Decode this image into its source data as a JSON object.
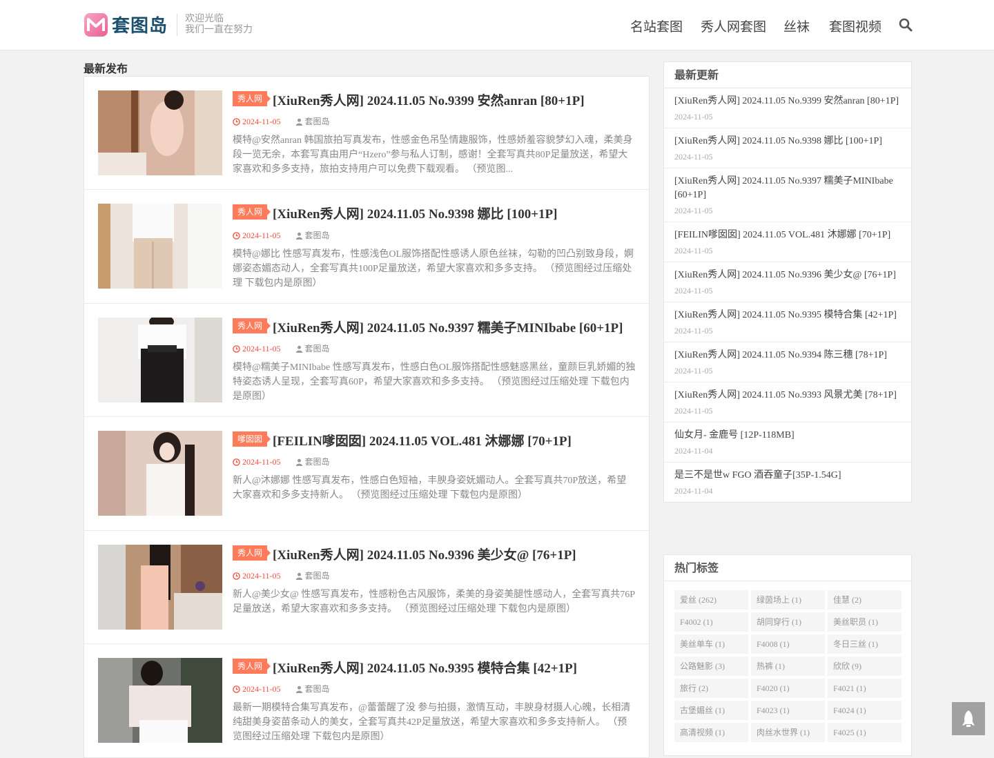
{
  "header": {
    "logo_text": "套图岛",
    "tagline_1": "欢迎光临",
    "tagline_2": "我们一直在努力",
    "nav": [
      "名站套图",
      "秀人网套图",
      "丝袜",
      "套图视频"
    ]
  },
  "main": {
    "section_title": "最新发布",
    "posts": [
      {
        "badge": "秀人网",
        "title": "[XiuRen秀人网] 2024.11.05 No.9399 安然anran [80+1P]",
        "date": "2024-11-05",
        "author": "套图岛",
        "excerpt": "模特@安然anran 韩国旅拍写真发布，性感金色吊坠情趣服饰，性感娇羞容貌梦幻入魂，柔美身段一览无余，本套写真由用户“Hzero”参与私人订制，感谢！全套写真共80P足量放送，希望大家喜欢和多多支持，旅拍支持用户可以免费下载观看。 （预览图..."
      },
      {
        "badge": "秀人网",
        "title": "[XiuRen秀人网] 2024.11.05 No.9398 娜比 [100+1P]",
        "date": "2024-11-05",
        "author": "套图岛",
        "excerpt": "模特@娜比 性感写真发布，性感浅色OL服饰搭配性感诱人原色丝袜，勾勒的凹凸别致身段，婀娜姿态媚态动人，全套写真共100P足量放送，希望大家喜欢和多多支持。 （预览图经过压缩处理 下载包内是原图）"
      },
      {
        "badge": "秀人网",
        "title": "[XiuRen秀人网] 2024.11.05 No.9397 糯美子MINIbabe [60+1P]",
        "date": "2024-11-05",
        "author": "套图岛",
        "excerpt": "模特@糯美子MINIbabe 性感写真发布，性感白色OL服饰搭配性感魅惑黑丝，童颜巨乳娇媚的独特姿态诱人呈现，全套写真60P，希望大家喜欢和多多支持。 （预览图经过压缩处理 下载包内是原图）"
      },
      {
        "badge": "嗲囡囡",
        "title": "[FEILIN嗲囡囡] 2024.11.05 VOL.481 沐娜娜 [70+1P]",
        "date": "2024-11-05",
        "author": "套图岛",
        "excerpt": "新人@沐娜娜 性感写真发布，性感白色短袖，丰腴身姿妩媚动人。全套写真共70P放送，希望大家喜欢和多多支持新人。 （预览图经过压缩处理 下载包内是原图）"
      },
      {
        "badge": "秀人网",
        "title": "[XiuRen秀人网] 2024.11.05 No.9396 美少女@ [76+1P]",
        "date": "2024-11-05",
        "author": "套图岛",
        "excerpt": "新人@美少女@ 性感写真发布，性感粉色古风服饰，柔美的身姿美腿性感动人，全套写真共76P足量放送，希望大家喜欢和多多支持。 （预览图经过压缩处理 下载包内是原图）"
      },
      {
        "badge": "秀人网",
        "title": "[XiuRen秀人网] 2024.11.05 No.9395 模特合集 [42+1P]",
        "date": "2024-11-05",
        "author": "套图岛",
        "excerpt": "最新一期模特合集写真发布，@蕾蕾醒了没 参与拍摄，激情互动，丰腴身材摄人心魄，长相清纯甜美身姿苗条动人的美女，全套写真共42P足量放送，希望大家喜欢和多多支持新人。 （预览图经过压缩处理 下载包内是原图）"
      }
    ]
  },
  "sidebar": {
    "recent_title": "最新更新",
    "recent": [
      {
        "title": "[XiuRen秀人网] 2024.11.05 No.9399 安然anran [80+1P]",
        "date": "2024-11-05"
      },
      {
        "title": "[XiuRen秀人网] 2024.11.05 No.9398 娜比 [100+1P]",
        "date": "2024-11-05"
      },
      {
        "title": "[XiuRen秀人网] 2024.11.05 No.9397 糯美子MINIbabe [60+1P]",
        "date": "2024-11-05"
      },
      {
        "title": "[FEILIN嗲囡囡] 2024.11.05 VOL.481 沐娜娜 [70+1P]",
        "date": "2024-11-05"
      },
      {
        "title": "[XiuRen秀人网] 2024.11.05 No.9396 美少女@ [76+1P]",
        "date": "2024-11-05"
      },
      {
        "title": "[XiuRen秀人网] 2024.11.05 No.9395 模特合集 [42+1P]",
        "date": "2024-11-05"
      },
      {
        "title": "[XiuRen秀人网] 2024.11.05 No.9394 陈三穗 [78+1P]",
        "date": "2024-11-05"
      },
      {
        "title": "[XiuRen秀人网] 2024.11.05 No.9393 风景尤美 [78+1P]",
        "date": "2024-11-05"
      },
      {
        "title": "仙女月- 金鹿号 [12P-118MB]",
        "date": "2024-11-04"
      },
      {
        "title": "是三不是世w FGO 酒吞童子[35P-1.54G]",
        "date": "2024-11-04"
      }
    ],
    "tags_title": "热门标签",
    "tags": [
      "爱丝 (262)",
      "绿茵场上 (1)",
      "佳慧 (2)",
      "F4002 (1)",
      "胡同穿行 (1)",
      "美丝职员 (1)",
      "美丝单车 (1)",
      "F4008 (1)",
      "冬日三丝 (1)",
      "公路魅影 (3)",
      "热裤 (1)",
      "欣欣 (9)",
      "旅行 (2)",
      "F4020 (1)",
      "F4021 (1)",
      "古堡媚丝 (1)",
      "F4023 (1)",
      "F4024 (1)",
      "高清视频 (1)",
      "肉丝水世界 (1)",
      "F4025 (1)"
    ]
  },
  "colors": {
    "accent": "#ff7b5a",
    "date": "#f14c3b",
    "logo_text": "#1d4f6e"
  }
}
